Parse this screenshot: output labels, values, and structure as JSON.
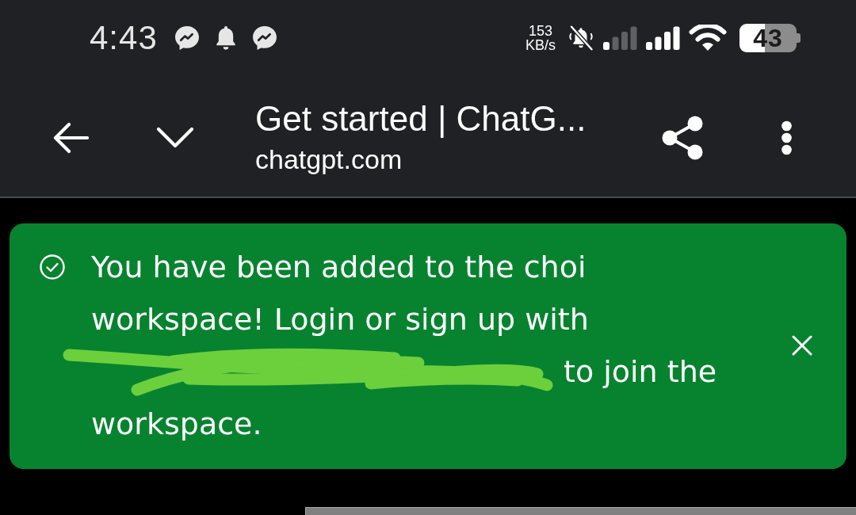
{
  "status_bar": {
    "time": "4:43",
    "speed_value": "153",
    "speed_unit": "KB/s",
    "battery": "43"
  },
  "toolbar": {
    "title": "Get started | ChatG...",
    "url": "chatgpt.com"
  },
  "banner": {
    "message": "You have been added to the choi workspace! Login or sign up with",
    "continuation": "to join the",
    "last_line": "workspace."
  }
}
